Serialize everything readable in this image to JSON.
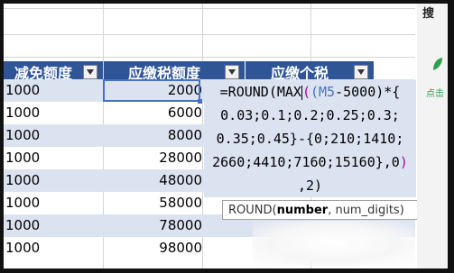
{
  "header": {
    "col_a": "减免额度",
    "col_b": "应缴税额度",
    "col_c": "应缴个税"
  },
  "rows": [
    {
      "a": "1000",
      "b": "2000"
    },
    {
      "a": "1000",
      "b": "6000"
    },
    {
      "a": "1000",
      "b": "8000"
    },
    {
      "a": "1000",
      "b": "28000"
    },
    {
      "a": "1000",
      "b": "48000"
    },
    {
      "a": "1000",
      "b": "58000"
    },
    {
      "a": "1000",
      "b": "78000"
    },
    {
      "a": "1000",
      "b": "98000"
    }
  ],
  "formula": {
    "l1_a": "=ROUND(MAX",
    "l1_b": "(",
    "l1_c": "(M5",
    "l1_d": "-5000)*{",
    "l2": "0.03;0.1;0.2;0.25;0.3;",
    "l3": "0.35;0.45}-{0;210;1410;",
    "l4_a": "2660;4410;7160;15160},0",
    "l4_b": ")",
    "l5": ",2)"
  },
  "tooltip": {
    "fn": "ROUND(",
    "arg1": "number",
    "rest": ", num_digits)"
  },
  "side": {
    "search_label": "搜",
    "click_label": "点击"
  },
  "colors": {
    "header_bg": "#2f5597",
    "row_shade": "#dbe3f1",
    "selection": "#4472c4"
  }
}
